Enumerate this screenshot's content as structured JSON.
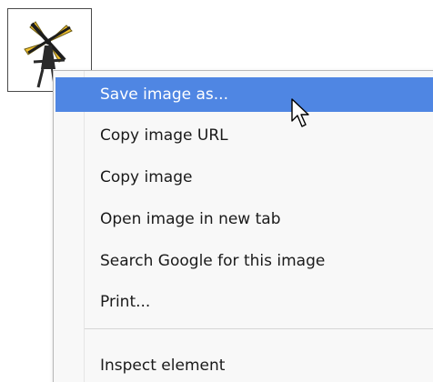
{
  "image": {
    "icon": "windmill-image"
  },
  "context_menu": {
    "items": [
      {
        "label": "Save image as...",
        "highlighted": true
      },
      {
        "label": "Copy image URL"
      },
      {
        "label": "Copy image"
      },
      {
        "label": "Open image in new tab"
      },
      {
        "label": "Search Google for this image"
      },
      {
        "label": "Print..."
      },
      {
        "label": "Inspect element"
      }
    ]
  },
  "cursor": {
    "icon": "arrow-cursor-icon"
  },
  "colors": {
    "highlight": "#4f86e3",
    "menu_background": "#f8f8f8",
    "image_yellow": "#f2c230"
  }
}
